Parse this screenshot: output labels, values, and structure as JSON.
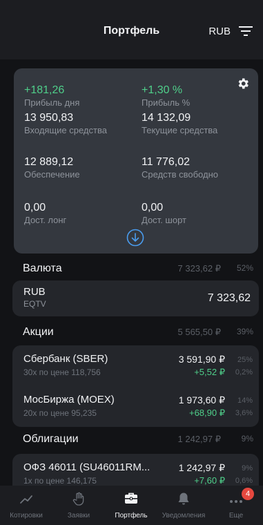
{
  "header": {
    "title": "Портфель",
    "currency": "RUB"
  },
  "summary": {
    "day_profit": {
      "value": "+181,26",
      "label": "Прибыль дня"
    },
    "profit_pct": {
      "value": "+1,30 %",
      "label": "Прибыль %"
    },
    "incoming": {
      "value": "13 950,83",
      "label": "Входящие средства"
    },
    "current": {
      "value": "14 132,09",
      "label": "Текущие средства"
    },
    "collateral": {
      "value": "12 889,12",
      "label": "Обеспечение"
    },
    "free": {
      "value": "11 776,02",
      "label": "Средств свободно"
    },
    "long": {
      "value": "0,00",
      "label": "Дост. лонг"
    },
    "short": {
      "value": "0,00",
      "label": "Дост. шорт"
    }
  },
  "sections": {
    "currency": {
      "name": "Валюта",
      "amount": "7 323,62 ₽",
      "pct": "52%"
    },
    "stocks": {
      "name": "Акции",
      "amount": "5 565,50 ₽",
      "pct": "39%"
    },
    "bonds": {
      "name": "Облигации",
      "amount": "1 242,97 ₽",
      "pct": "9%"
    }
  },
  "currency_item": {
    "name": "RUB",
    "sub": "EQTV",
    "amount": "7 323,62"
  },
  "stocks": [
    {
      "name": "Сбербанк (SBER)",
      "sub": "30x по цене 118,756",
      "amount": "3 591,90 ₽",
      "change": "+5,52 ₽",
      "pct": "25%",
      "change_pct": "0,2%"
    },
    {
      "name": "МосБиржа (MOEX)",
      "sub": "20x по цене 95,235",
      "amount": "1 973,60 ₽",
      "change": "+68,90 ₽",
      "pct": "14%",
      "change_pct": "3,6%"
    }
  ],
  "bonds": [
    {
      "name": "ОФЗ 46011 (SU46011RM...",
      "sub": "1x по цене 146,175",
      "amount": "1 242,97 ₽",
      "change": "+7,60 ₽",
      "pct": "9%",
      "change_pct": "0,6%"
    }
  ],
  "tabs": [
    {
      "label": "Котировки",
      "icon": "chart-line-icon"
    },
    {
      "label": "Заявки",
      "icon": "hand-icon"
    },
    {
      "label": "Портфель",
      "icon": "briefcase-icon"
    },
    {
      "label": "Уведомления",
      "icon": "bell-icon"
    },
    {
      "label": "Еще",
      "icon": "more-dots-icon",
      "badge": "4"
    }
  ],
  "colors": {
    "positive": "#4fcf8a",
    "badge": "#e5483f",
    "card": "#34383f"
  }
}
